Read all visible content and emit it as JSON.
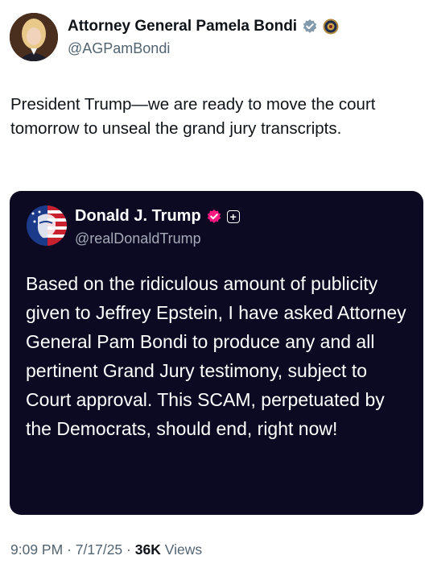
{
  "author": {
    "name": "Attorney General Pamela Bondi",
    "handle": "@AGPamBondi"
  },
  "tweet": {
    "text": "President Trump—we are ready to move the court tomorrow to unseal the grand jury transcripts."
  },
  "quoted": {
    "name": "Donald J. Trump",
    "handle": "@realDonaldTrump",
    "badge_plus": "+",
    "text": "Based on the ridiculous amount of publicity given to Jeffrey Epstein, I have asked Attorney General Pam Bondi to produce any and all pertinent Grand Jury testimony, subject to Court approval. This SCAM, perpetuated by the Democrats, should end, right now!"
  },
  "meta": {
    "time": "9:09 PM",
    "date": "7/17/25",
    "views_count": "36K",
    "views_label": "Views"
  },
  "colors": {
    "verified_gray": "#829aab",
    "verified_pink": "#f91880",
    "quote_bg": "#0c0a22",
    "muted": "#536471"
  },
  "icons": [
    "gray-verified-icon",
    "government-seal-icon",
    "pink-verified-icon",
    "plus-badge-icon"
  ]
}
